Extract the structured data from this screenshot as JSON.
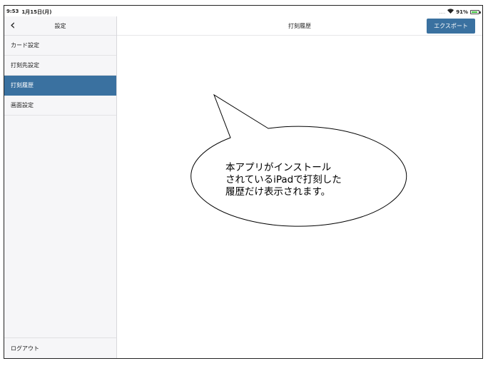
{
  "status_bar": {
    "time": "9:53",
    "date": "1月15日(月)",
    "signal": "....",
    "wifi_icon": "wifi-icon",
    "battery": "91%",
    "battery_color": "#3cc13c"
  },
  "sidebar": {
    "back_icon": "chevron-left-icon",
    "title": "設定",
    "items": [
      {
        "label": "カード設定",
        "active": false
      },
      {
        "label": "打刻先設定",
        "active": false
      },
      {
        "label": "打刻履歴",
        "active": true
      },
      {
        "label": "画面設定",
        "active": false
      }
    ],
    "footer_label": "ログアウト"
  },
  "main": {
    "title": "打刻履歴",
    "export_label": "エクスポート"
  },
  "callout": {
    "text": "本アプリがインストール\nされているiPadで打刻した\n履歴だけ表示されます。"
  },
  "colors": {
    "accent": "#3a71a0",
    "sidebar_bg": "#f6f6f8"
  }
}
